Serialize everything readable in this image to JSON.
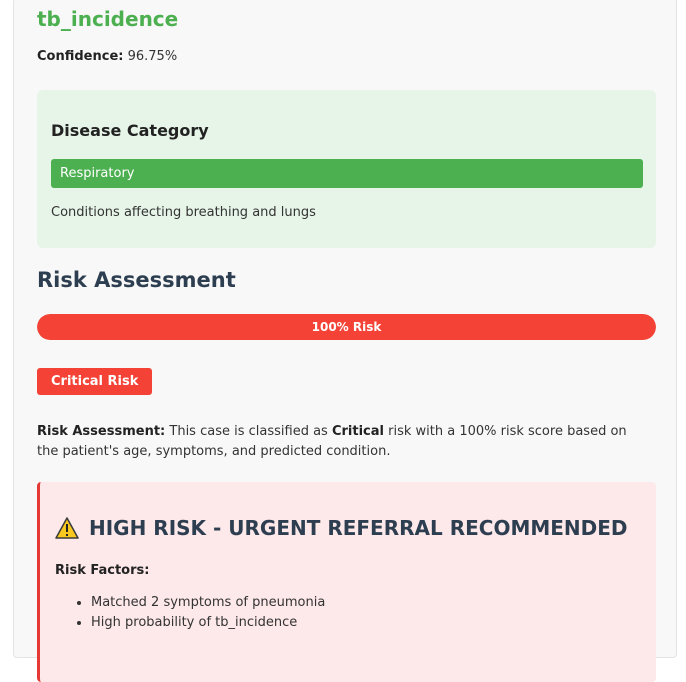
{
  "prediction": {
    "title": "tb_incidence",
    "confidence_label": "Confidence:",
    "confidence_value": "96.75%"
  },
  "category": {
    "heading": "Disease Category",
    "tag": "Respiratory",
    "description": "Conditions affecting breathing and lungs",
    "color": "#4caf50"
  },
  "risk": {
    "heading": "Risk Assessment",
    "bar_label": "100% Risk",
    "score_fraction": 1.0,
    "badge": "Critical Risk",
    "color": "#f44336",
    "text_label": "Risk Assessment:",
    "text_part1": "This case is classified as",
    "text_level": "Critical",
    "text_part2": "risk with a 100% risk score based on the patient's age, symptoms, and predicted condition."
  },
  "alert": {
    "icon": "warning-icon",
    "heading": "HIGH RISK - URGENT REFERRAL RECOMMENDED",
    "factors_label": "Risk Factors:",
    "factors": [
      "Matched 2 symptoms of pneumonia",
      "High probability of tb_incidence"
    ]
  }
}
